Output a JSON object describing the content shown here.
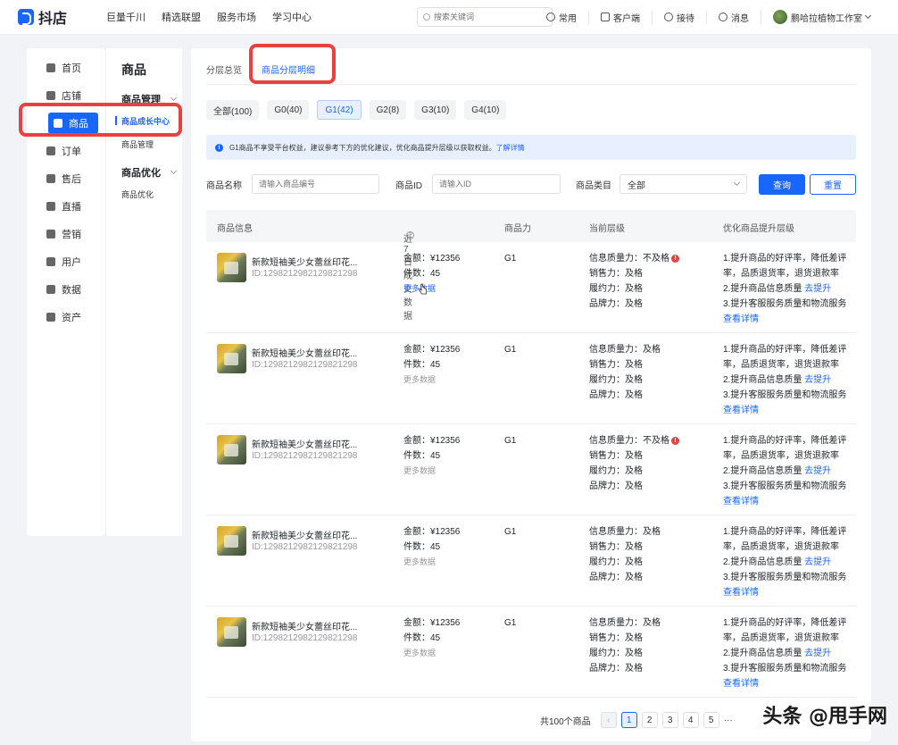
{
  "brand": {
    "name": "抖店",
    "color": "#1966ff"
  },
  "topnav": [
    "巨量千川",
    "精选联盟",
    "服务市场",
    "学习中心"
  ],
  "search": {
    "placeholder": "搜索关键词"
  },
  "top_right": {
    "frequent": "常用",
    "client": "客户端",
    "reception": "接待",
    "messages": "消息",
    "shop": "鹏哈拉植物工作室"
  },
  "sidebar": {
    "items": [
      {
        "label": "首页",
        "icon": "home-icon"
      },
      {
        "label": "店铺",
        "icon": "store-icon"
      },
      {
        "label": "商品",
        "icon": "product-icon",
        "active": true
      },
      {
        "label": "订单",
        "icon": "order-icon"
      },
      {
        "label": "售后",
        "icon": "after-sale-icon"
      },
      {
        "label": "直播",
        "icon": "live-icon"
      },
      {
        "label": "营销",
        "icon": "marketing-icon"
      },
      {
        "label": "用户",
        "icon": "user-icon"
      },
      {
        "label": "数据",
        "icon": "data-icon"
      },
      {
        "label": "资产",
        "icon": "asset-icon"
      }
    ]
  },
  "sub_sidebar": {
    "title": "商品",
    "group1": "商品管理",
    "item_growth": "商品成长中心",
    "item_manage": "商品管理",
    "group2": "商品优化",
    "item_optimize": "商品优化"
  },
  "tabs": {
    "overview": "分层总览",
    "detail": "商品分层明细"
  },
  "segments": [
    "全部(100)",
    "G0(40)",
    "G1(42)",
    "G2(8)",
    "G3(10)",
    "G4(10)"
  ],
  "segment_active": "G1(42)",
  "notice": {
    "text": "G1商品不享受平台权益，建议参考下方的优化建议，优化商品提升层级以获取权益。",
    "link": "了解详情"
  },
  "filters": {
    "name_label": "商品名称",
    "name_placeholder": "请输入商品编号",
    "id_label": "商品ID",
    "id_placeholder": "请输入ID",
    "category_label": "商品类目",
    "category_value": "全部",
    "query": "查询",
    "reset": "重置"
  },
  "table": {
    "headers": {
      "info": "商品信息",
      "sales": "近7日成交数据",
      "power": "商品力",
      "level": "当前层级",
      "improve": "优化商品提升层级"
    },
    "rows": [
      {
        "name": "新款短袖美少女蕾丝印花...",
        "id": "ID:1298212982129821298",
        "amount": "金额：¥12356",
        "count": "件数：45",
        "more": "更多数据",
        "more_active": true,
        "power": "G1",
        "quality": "信息质量力：不及格",
        "quality_warn": true,
        "sell": "销售力：及格",
        "fulfill": "履约力：及格",
        "brand": "品牌力：及格",
        "tip1a": "1.提升商品的好评率，降低差评",
        "tip1b": "率，品质退货率，退货退款率",
        "tip2": "2.提升商品信息质量",
        "tip2_link": "去提升",
        "tip3": "3.提升客服服务质量和物流服务",
        "detail": "查看详情"
      },
      {
        "name": "新款短袖美少女蕾丝印花...",
        "id": "ID:1298212982129821298",
        "amount": "金额：¥12356",
        "count": "件数：45",
        "more": "更多数据",
        "more_active": false,
        "power": "G1",
        "quality": "信息质量力：及格",
        "quality_warn": false,
        "sell": "销售力：及格",
        "fulfill": "履约力：及格",
        "brand": "品牌力：及格",
        "tip1a": "1.提升商品的好评率，降低差评",
        "tip1b": "率，品质退货率，退货退款率",
        "tip2": "2.提升商品信息质量",
        "tip2_link": "去提升",
        "tip3": "3.提升客服服务质量和物流服务",
        "detail": "查看详情"
      },
      {
        "name": "新款短袖美少女蕾丝印花...",
        "id": "ID:1298212982129821298",
        "amount": "金额：¥12356",
        "count": "件数：45",
        "more": "更多数据",
        "more_active": false,
        "power": "G1",
        "quality": "信息质量力：不及格",
        "quality_warn": true,
        "sell": "销售力：及格",
        "fulfill": "履约力：及格",
        "brand": "品牌力：及格",
        "tip1a": "1.提升商品的好评率，降低差评",
        "tip1b": "率，品质退货率，退货退款率",
        "tip2": "2.提升商品信息质量",
        "tip2_link": "去提升",
        "tip3": "3.提升客服服务质量和物流服务",
        "detail": "查看详情"
      },
      {
        "name": "新款短袖美少女蕾丝印花...",
        "id": "ID:1298212982129821298",
        "amount": "金额：¥12356",
        "count": "件数：45",
        "more": "更多数据",
        "more_active": false,
        "power": "G1",
        "quality": "信息质量力：及格",
        "quality_warn": false,
        "sell": "销售力：及格",
        "fulfill": "履约力：及格",
        "brand": "品牌力：及格",
        "tip1a": "1.提升商品的好评率，降低差评",
        "tip1b": "率，品质退货率，退货退款率",
        "tip2": "2.提升商品信息质量",
        "tip2_link": "去提升",
        "tip3": "3.提升客服服务质量和物流服务",
        "detail": "查看详情"
      },
      {
        "name": "新款短袖美少女蕾丝印花...",
        "id": "ID:1298212982129821298",
        "amount": "金额：¥12356",
        "count": "件数：45",
        "more": "更多数据",
        "more_active": false,
        "power": "G1",
        "quality": "信息质量力：及格",
        "quality_warn": false,
        "sell": "销售力：及格",
        "fulfill": "履约力：及格",
        "brand": "品牌力：及格",
        "tip1a": "1.提升商品的好评率，降低差评",
        "tip1b": "率，品质退货率，退货退款率",
        "tip2": "2.提升商品信息质量",
        "tip2_link": "去提升",
        "tip3": "3.提升客服服务质量和物流服务",
        "detail": "查看详情"
      }
    ]
  },
  "pagination": {
    "total": "共100个商品",
    "pages": [
      "1",
      "2",
      "3",
      "4",
      "5"
    ],
    "ellipsis": "···",
    "current": "1"
  },
  "watermark": "头条 @甩手网"
}
